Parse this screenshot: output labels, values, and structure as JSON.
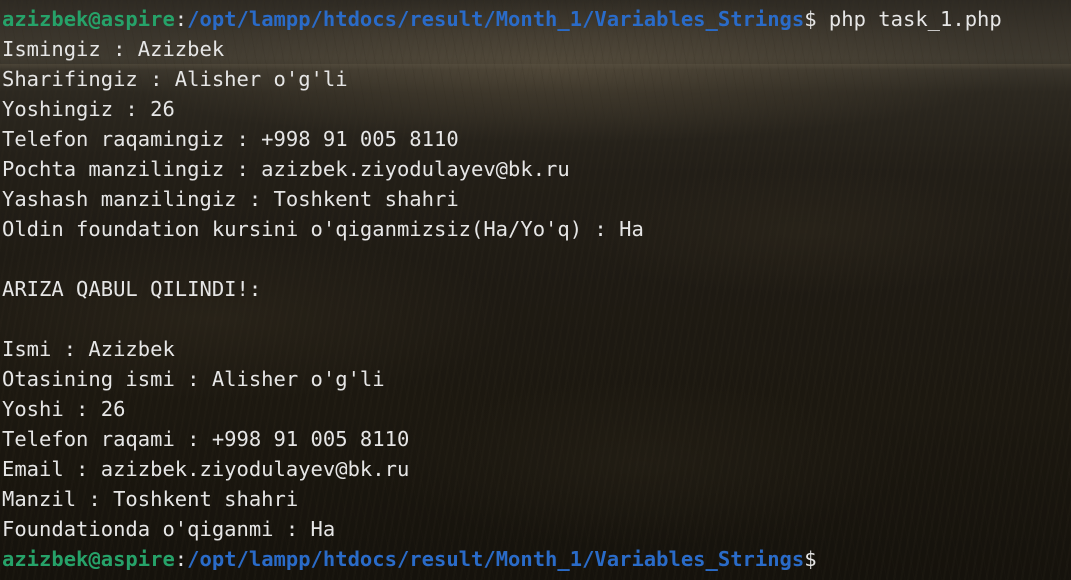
{
  "prompt": {
    "user_host": "azizbek@aspire",
    "separator": ":",
    "path": "/opt/lampp/htdocs/result/Month_1/Variables_Strings",
    "symbol": "$",
    "command": " php task_1.php"
  },
  "output_lines": [
    "Ismingiz : Azizbek",
    "Sharifingiz : Alisher o'g'li",
    "Yoshingiz : 26",
    "Telefon raqamingiz : +998 91 005 8110",
    "Pochta manzilingiz : azizbek.ziyodulayev@bk.ru",
    "Yashash manzilingiz : Toshkent shahri",
    "Oldin foundation kursini o'qiganmizsiz(Ha/Yo'q) : Ha",
    "",
    "ARIZA QABUL QILINDI!:",
    "",
    "Ismi : Azizbek",
    "Otasining ismi : Alisher o'g'li",
    "Yoshi : 26",
    "Telefon raqami : +998 91 005 8110",
    "Email : azizbek.ziyodulayev@bk.ru",
    "Manzil : Toshkent shahri",
    "Foundationda o'qiganmi : Ha"
  ],
  "colors": {
    "user_host": "#26a269",
    "path": "#2a6bc8",
    "text": "#e6e6e6"
  }
}
